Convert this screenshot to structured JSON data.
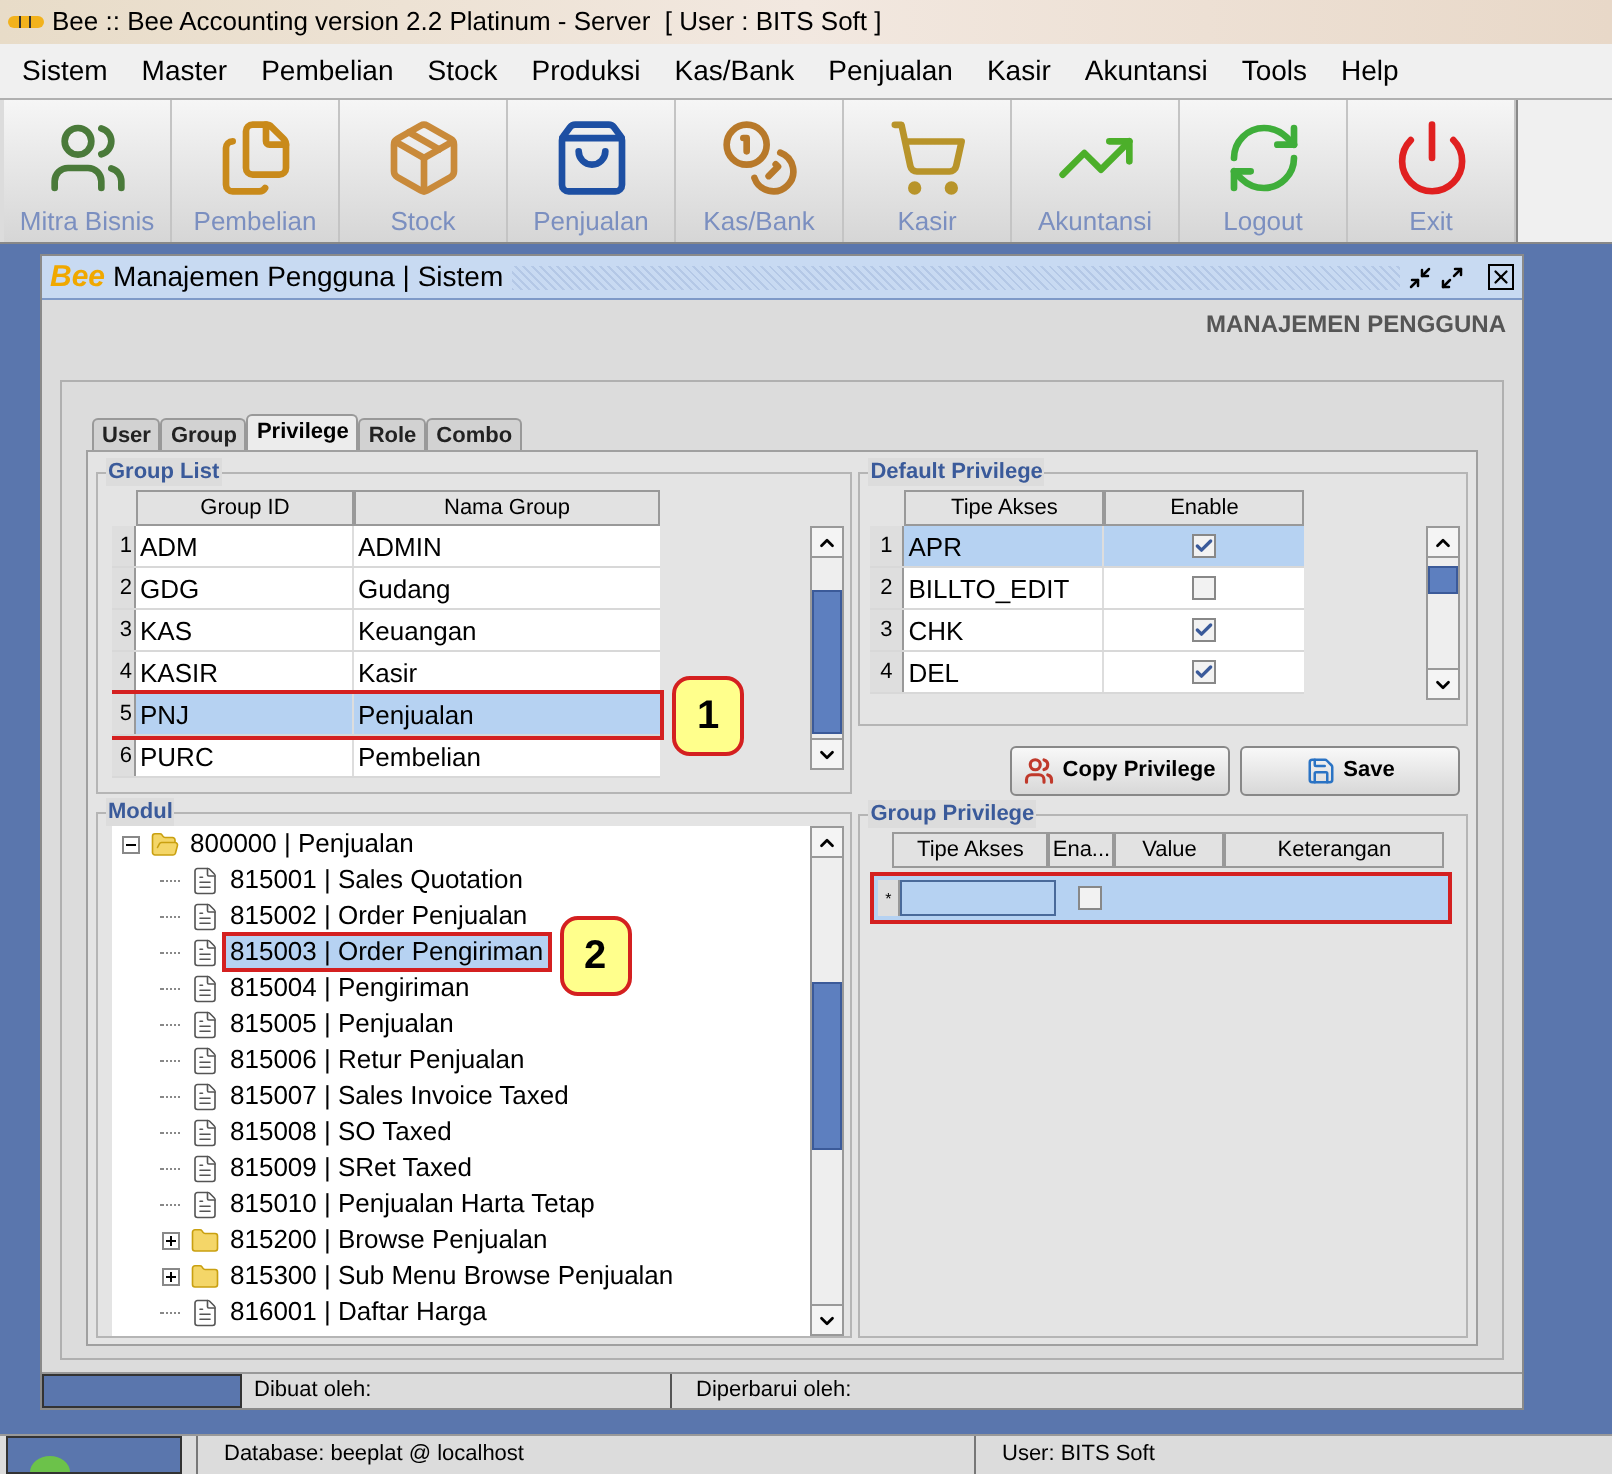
{
  "window": {
    "title": "Bee :: Bee Accounting version 2.2 Platinum - Server  [ User : BITS Soft ]"
  },
  "menu": [
    "Sistem",
    "Master",
    "Pembelian",
    "Stock",
    "Produksi",
    "Kas/Bank",
    "Penjualan",
    "Kasir",
    "Akuntansi",
    "Tools",
    "Help"
  ],
  "toolbar": [
    {
      "label": "Mitra Bisnis",
      "kind": "partners"
    },
    {
      "label": "Pembelian",
      "kind": "purchase"
    },
    {
      "label": "Stock",
      "kind": "stock"
    },
    {
      "label": "Penjualan",
      "kind": "sales"
    },
    {
      "label": "Kas/Bank",
      "kind": "cash"
    },
    {
      "label": "Kasir",
      "kind": "cashier"
    },
    {
      "label": "Akuntansi",
      "kind": "accounting"
    },
    {
      "label": "Logout",
      "kind": "logout"
    },
    {
      "label": "Exit",
      "kind": "exit"
    }
  ],
  "frame": {
    "logo": "Bee",
    "title": "Manajemen Pengguna | Sistem",
    "heading": "MANAJEMEN PENGGUNA",
    "tabs": [
      {
        "label": "User",
        "selected": false
      },
      {
        "label": "Group",
        "selected": false
      },
      {
        "label": "Privilege",
        "selected": true
      },
      {
        "label": "Role",
        "selected": false
      },
      {
        "label": "Combo",
        "selected": false
      }
    ],
    "group_list": {
      "title": "Group List",
      "columns": [
        "Group ID",
        "Nama Group"
      ],
      "callout": "1",
      "rows": [
        {
          "no": "1",
          "id": "ADM",
          "name": "ADMIN",
          "selected": false,
          "highlighted": false
        },
        {
          "no": "2",
          "id": "GDG",
          "name": "Gudang",
          "selected": false,
          "highlighted": false
        },
        {
          "no": "3",
          "id": "KAS",
          "name": "Keuangan",
          "selected": false,
          "highlighted": false
        },
        {
          "no": "4",
          "id": "KASIR",
          "name": "Kasir",
          "selected": false,
          "highlighted": false
        },
        {
          "no": "5",
          "id": "PNJ",
          "name": "Penjualan",
          "selected": true,
          "highlighted": true
        },
        {
          "no": "6",
          "id": "PURC",
          "name": "Pembelian",
          "selected": false,
          "highlighted": false
        }
      ]
    },
    "default_privilege": {
      "title": "Default Privilege",
      "columns": [
        "Tipe Akses",
        "Enable"
      ],
      "rows": [
        {
          "no": "1",
          "type": "APR",
          "enabled": true,
          "selected": true
        },
        {
          "no": "2",
          "type": "BILLTO_EDIT",
          "enabled": false,
          "selected": false
        },
        {
          "no": "3",
          "type": "CHK",
          "enabled": true,
          "selected": false
        },
        {
          "no": "4",
          "type": "DEL",
          "enabled": true,
          "selected": false
        }
      ]
    },
    "buttons": [
      {
        "label": "Copy Privilege",
        "kind": "copy"
      },
      {
        "label": "Save",
        "kind": "save"
      }
    ],
    "modul": {
      "title": "Modul",
      "callout": "2",
      "tree": [
        {
          "label": "800000 | Penjualan",
          "kind": "folder",
          "expanded": true,
          "selected": false,
          "highlighted": false,
          "children": [
            {
              "label": "815001 | Sales Quotation",
              "kind": "file",
              "selected": false,
              "highlighted": false
            },
            {
              "label": "815002 | Order Penjualan",
              "kind": "file",
              "selected": false,
              "highlighted": false
            },
            {
              "label": "815003 | Order Pengiriman",
              "kind": "file",
              "selected": true,
              "highlighted": true
            },
            {
              "label": "815004 | Pengiriman",
              "kind": "file",
              "selected": false,
              "highlighted": false
            },
            {
              "label": "815005 | Penjualan",
              "kind": "file",
              "selected": false,
              "highlighted": false
            },
            {
              "label": "815006 | Retur Penjualan",
              "kind": "file",
              "selected": false,
              "highlighted": false
            },
            {
              "label": "815007 | Sales Invoice Taxed",
              "kind": "file",
              "selected": false,
              "highlighted": false
            },
            {
              "label": "815008 | SO Taxed",
              "kind": "file",
              "selected": false,
              "highlighted": false
            },
            {
              "label": "815009 | SRet Taxed",
              "kind": "file",
              "selected": false,
              "highlighted": false
            },
            {
              "label": "815010 | Penjualan Harta Tetap",
              "kind": "file",
              "selected": false,
              "highlighted": false
            },
            {
              "label": "815200 | Browse Penjualan",
              "kind": "folder",
              "expanded": false,
              "selected": false,
              "highlighted": false
            },
            {
              "label": "815300 | Sub Menu Browse Penjualan",
              "kind": "folder",
              "expanded": false,
              "selected": false,
              "highlighted": false
            },
            {
              "label": "816001 | Daftar Harga",
              "kind": "file",
              "selected": false,
              "highlighted": false
            }
          ]
        }
      ]
    },
    "group_privilege": {
      "title": "Group Privilege",
      "columns": [
        "Tipe Akses",
        "Ena...",
        "Value",
        "Keterangan"
      ],
      "new_row": {
        "marker": "*",
        "enabled": false,
        "highlighted": true
      }
    },
    "status": [
      "Dibuat oleh:",
      "Diperbarui oleh:"
    ]
  },
  "status_bar": {
    "database": "Database: beeplat @ localhost",
    "user": "User: BITS Soft"
  }
}
